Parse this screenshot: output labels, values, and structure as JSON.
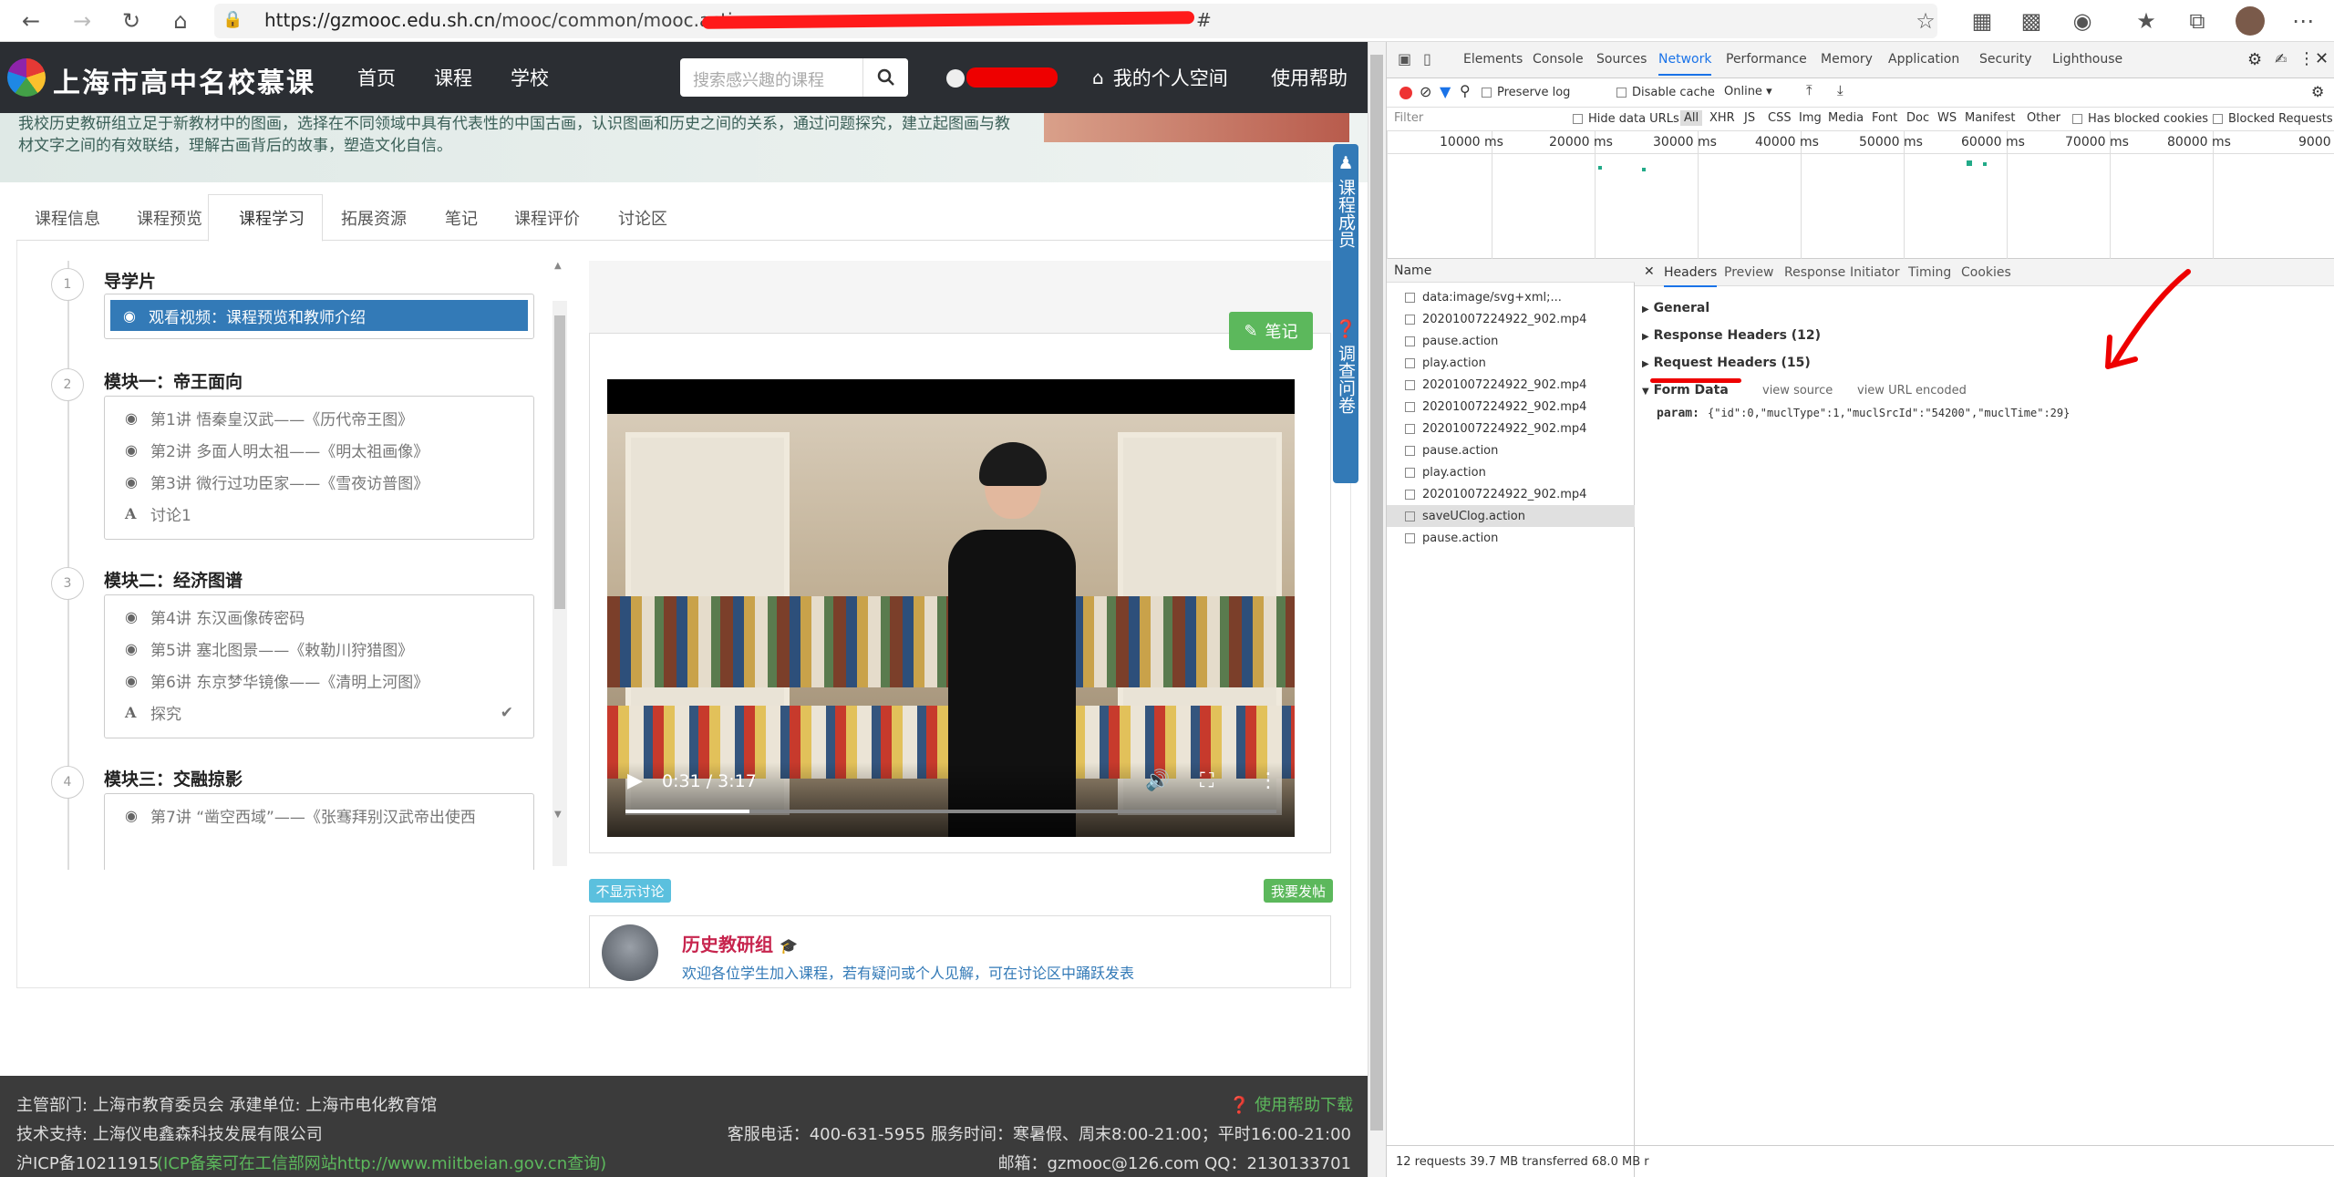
{
  "browser": {
    "url_host": "https://gzmooc.edu.sh.cn",
    "url_path": "/mooc/common/mooc.action",
    "url_tail": "#",
    "redacted": true
  },
  "site": {
    "logo_text": "上海市高中名校慕课",
    "nav": [
      "首页",
      "课程",
      "学校"
    ],
    "search_placeholder": "搜索感兴趣的课程",
    "my_space": "我的个人空间",
    "help": "使用帮助"
  },
  "banner_text": "我校历史教研组立足于新教材中的图画，选择在不同领域中具有代表性的中国古画，认识图画和历史之间的关系，通过问题探究，建立起图画与教材文字之间的有效联结，理解古画背后的故事，塑造文化自信。",
  "course_tabs": [
    "课程信息",
    "课程预览",
    "课程学习",
    "拓展资源",
    "笔记",
    "课程评价",
    "讨论区"
  ],
  "active_tab": "课程学习",
  "outline": [
    {
      "num": "1",
      "title": "导学片",
      "items": [
        {
          "label": "观看视频：课程预览和教师介绍",
          "icon": "play",
          "active": true
        }
      ]
    },
    {
      "num": "2",
      "title": "模块一：帝王面向",
      "items": [
        {
          "label": "第1讲 悟秦皇汉武——《历代帝王图》",
          "icon": "play"
        },
        {
          "label": "第2讲 多面人明太祖——《明太祖画像》",
          "icon": "play"
        },
        {
          "label": "第3讲 微行过功臣家——《雪夜访普图》",
          "icon": "play"
        },
        {
          "label": "讨论1",
          "icon": "A"
        }
      ]
    },
    {
      "num": "3",
      "title": "模块二：经济图谱",
      "items": [
        {
          "label": "第4讲 东汉画像砖密码",
          "icon": "play"
        },
        {
          "label": "第5讲 塞北图景——《敕勒川狩猎图》",
          "icon": "play"
        },
        {
          "label": "第6讲 东京梦华镜像——《清明上河图》",
          "icon": "play"
        },
        {
          "label": "探究",
          "icon": "A",
          "done": true
        }
      ]
    },
    {
      "num": "4",
      "title": "模块三：交融掠影",
      "items": [
        {
          "label": "第7讲 “凿空西域”——《张骞拜别汉武帝出使西",
          "icon": "play"
        }
      ]
    }
  ],
  "note_button": "笔记",
  "video": {
    "time": "0:31 / 3:17",
    "progress": 0.19
  },
  "side_floats": [
    "课程成员",
    "调查问卷"
  ],
  "discussion": {
    "hide_button": "不显示讨论",
    "post_button": "我要发帖",
    "author": "历史教研组",
    "text": "欢迎各位学生加入课程，若有疑问或个人见解，可在讨论区中踊跃发表"
  },
  "footer": {
    "row1_left": "主管部门:  上海市教育委员会    承建单位: 上海市电化教育馆",
    "row1_right": "使用帮助下载",
    "row2_left": "技术支持:  上海仪电鑫森科技发展有限公司",
    "row2_right": "客服电话：400-631-5955 服务时间：寒暑假、周末8:00-21:00；平时16:00-21:00",
    "row3_left": "沪ICP备10211915",
    "row3_link": "(ICP备案可在工信部网站http://www.miitbeian.gov.cn查询)",
    "row3_right": "邮箱：gzmooc@126.com    QQ：2130133701"
  },
  "devtools": {
    "tabs": [
      "Elements",
      "Console",
      "Sources",
      "Network",
      "Performance",
      "Memory",
      "Application",
      "Security",
      "Lighthouse"
    ],
    "active_tab": "Network",
    "toolbar": {
      "preserve_log": "Preserve log",
      "disable_cache": "Disable cache",
      "throttle": "Online"
    },
    "filter": {
      "placeholder": "Filter",
      "hide_data_urls": "Hide data URLs",
      "types": [
        "All",
        "XHR",
        "JS",
        "CSS",
        "Img",
        "Media",
        "Font",
        "Doc",
        "WS",
        "Manifest",
        "Other"
      ],
      "has_blocked_cookies": "Has blocked cookies",
      "blocked_requests": "Blocked Requests"
    },
    "timeline_labels": [
      "10000 ms",
      "20000 ms",
      "30000 ms",
      "40000 ms",
      "50000 ms",
      "60000 ms",
      "70000 ms",
      "80000 ms",
      "9000"
    ],
    "name_header": "Name",
    "requests": [
      "data:image/svg+xml;...",
      "20201007224922_902.mp4",
      "pause.action",
      "play.action",
      "20201007224922_902.mp4",
      "20201007224922_902.mp4",
      "20201007224922_902.mp4",
      "pause.action",
      "play.action",
      "20201007224922_902.mp4",
      "saveUClog.action",
      "pause.action"
    ],
    "selected_request": 10,
    "detail_tabs": [
      "Headers",
      "Preview",
      "Response",
      "Initiator",
      "Timing",
      "Cookies"
    ],
    "sections": {
      "general": "General",
      "response_headers": "Response Headers (12)",
      "request_headers": "Request Headers (15)",
      "form_data": "Form Data",
      "view_source": "view source",
      "view_url_encoded": "view URL encoded"
    },
    "param_key": "param:",
    "param_value": "{\"id\":0,\"muclType\":1,\"muclSrcId\":\"54200\",\"muclTime\":29}",
    "status": "12 requests    39.7 MB transferred    68.0 MB r"
  }
}
